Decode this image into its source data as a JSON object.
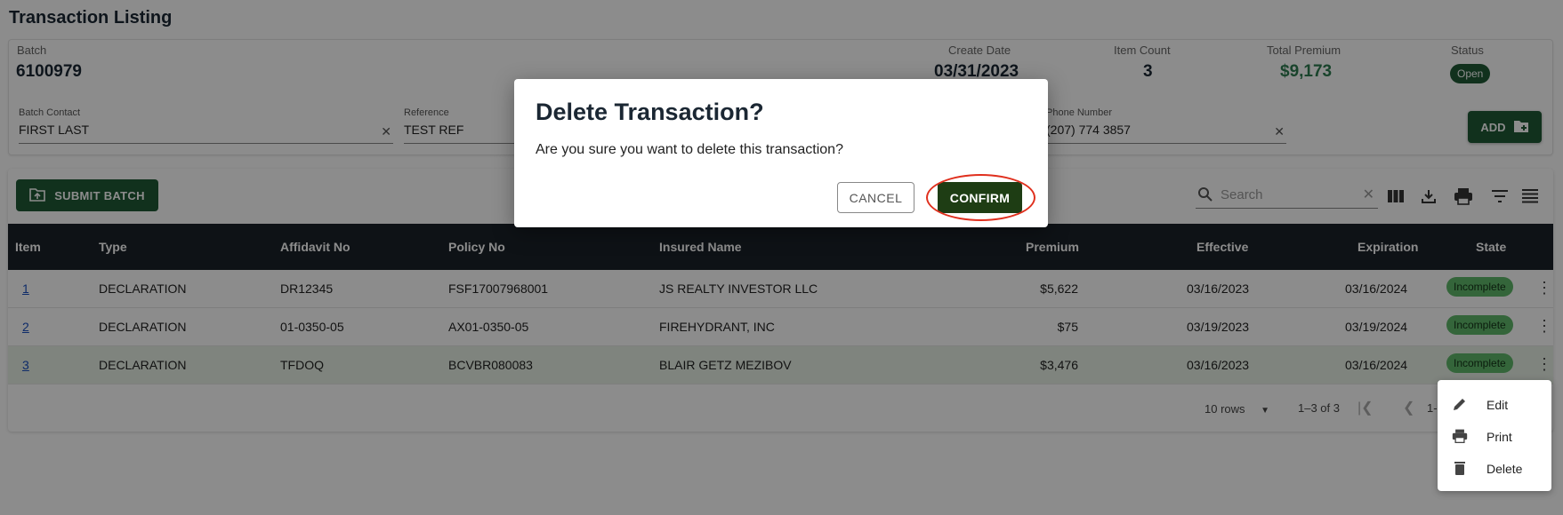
{
  "page": {
    "title": "Transaction Listing"
  },
  "batch": {
    "batch_label": "Batch",
    "batch_value": "6100979",
    "create_date_label": "Create Date",
    "create_date_value": "03/31/2023",
    "item_count_label": "Item Count",
    "item_count_value": "3",
    "total_premium_label": "Total Premium",
    "total_premium_value": "$9,173",
    "status_label": "Status",
    "status_value": "Open",
    "contact_label": "Batch Contact",
    "contact_value": "FIRST LAST",
    "reference_label": "Reference",
    "reference_value": "TEST REF",
    "phone_label": "Phone Number",
    "phone_value": "(207) 774 3857",
    "add_label": "ADD"
  },
  "toolbar": {
    "submit_label": "SUBMIT BATCH",
    "search_placeholder": "Search",
    "icons": [
      "columns-icon",
      "download-icon",
      "print-icon",
      "filter-icon",
      "density-icon"
    ]
  },
  "table": {
    "columns": [
      "Item",
      "Type",
      "Affidavit No",
      "Policy No",
      "Insured Name",
      "Premium",
      "Effective",
      "Expiration",
      "State"
    ],
    "rows": [
      {
        "item": "1",
        "type": "DECLARATION",
        "affidavit": "DR12345",
        "policy": "FSF17007968001",
        "insured": "JS REALTY INVESTOR LLC",
        "premium": "$5,622",
        "effective": "03/16/2023",
        "expiration": "03/16/2024",
        "state": "Incomplete"
      },
      {
        "item": "2",
        "type": "DECLARATION",
        "affidavit": "01-0350-05",
        "policy": "AX01-0350-05",
        "insured": "FIREHYDRANT, INC",
        "premium": "$75",
        "effective": "03/19/2023",
        "expiration": "03/19/2024",
        "state": "Incomplete"
      },
      {
        "item": "3",
        "type": "DECLARATION",
        "affidavit": "TFDOQ",
        "policy": "BCVBR080083",
        "insured": "BLAIR GETZ MEZIBOV",
        "premium": "$3,476",
        "effective": "03/16/2023",
        "expiration": "03/16/2024",
        "state": "Incomplete"
      }
    ]
  },
  "footer": {
    "rows_per_page": "10 rows",
    "range": "1–3 of 3",
    "page_partial": "1-"
  },
  "context_menu": {
    "edit": "Edit",
    "print": "Print",
    "delete": "Delete"
  },
  "dialog": {
    "title": "Delete Transaction?",
    "message": "Are you sure you want to delete this transaction?",
    "cancel_label": "CANCEL",
    "confirm_label": "CONFIRM"
  },
  "colors": {
    "brand_green": "#1f5a36",
    "confirm_green": "#1e3d14",
    "header_dark": "#1b2229",
    "incomplete_pill": "#5fb86a",
    "annotation_red": "#e0301e"
  }
}
